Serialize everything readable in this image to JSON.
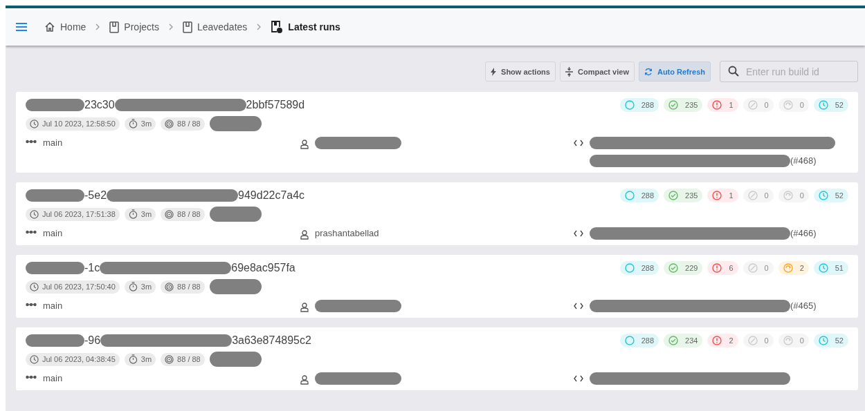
{
  "breadcrumbs": [
    {
      "label": "Home",
      "kind": "home"
    },
    {
      "label": "Projects",
      "kind": "project"
    },
    {
      "label": "Leavedates",
      "kind": "project"
    },
    {
      "label": "Latest runs",
      "kind": "runs"
    }
  ],
  "toolbar": {
    "buttons": [
      {
        "label": "Show actions",
        "kind": "actions",
        "selected": false
      },
      {
        "label": "Compact view",
        "kind": "compact",
        "selected": false
      },
      {
        "label": "Auto Refresh",
        "kind": "refresh",
        "selected": true
      }
    ],
    "search": {
      "placeholder": "Enter run build id"
    }
  },
  "runs": [
    {
      "title": [
        {
          "kind": "redacted"
        },
        {
          "kind": "text",
          "text": "23c30"
        },
        {
          "kind": "redacted"
        },
        {
          "kind": "text",
          "text": "2bbf57589d"
        }
      ],
      "date": "Jul 10 2023, 12:58:50",
      "duration": "3m",
      "tests": "88 / 88",
      "stats": [
        {
          "kind": "total",
          "value": "288",
          "muted": false
        },
        {
          "kind": "passed",
          "value": "235",
          "muted": false
        },
        {
          "kind": "failed",
          "value": "1",
          "muted": false
        },
        {
          "kind": "broken",
          "value": "0",
          "muted": true
        },
        {
          "kind": "flaky",
          "value": "0",
          "muted": true
        },
        {
          "kind": "time",
          "value": "52",
          "muted": false
        }
      ],
      "branch": "main",
      "author": [
        {
          "kind": "redacted"
        }
      ],
      "commit": [
        {
          "kind": "redacted"
        },
        {
          "kind": "redacted"
        },
        {
          "kind": "text",
          "text": "(#468)"
        }
      ]
    },
    {
      "title": [
        {
          "kind": "redacted"
        },
        {
          "kind": "text",
          "text": "-5e2"
        },
        {
          "kind": "redacted"
        },
        {
          "kind": "text",
          "text": "949d22c7a4c"
        }
      ],
      "date": "Jul 06 2023, 17:51:38",
      "duration": "3m",
      "tests": "88 / 88",
      "stats": [
        {
          "kind": "total",
          "value": "288",
          "muted": false
        },
        {
          "kind": "passed",
          "value": "235",
          "muted": false
        },
        {
          "kind": "failed",
          "value": "1",
          "muted": false
        },
        {
          "kind": "broken",
          "value": "0",
          "muted": true
        },
        {
          "kind": "flaky",
          "value": "0",
          "muted": true
        },
        {
          "kind": "time",
          "value": "52",
          "muted": false
        }
      ],
      "branch": "main",
      "author": [
        {
          "kind": "text",
          "text": "prashantabellad"
        }
      ],
      "commit": [
        {
          "kind": "redacted"
        },
        {
          "kind": "text",
          "text": "(#466)"
        }
      ]
    },
    {
      "title": [
        {
          "kind": "redacted"
        },
        {
          "kind": "text",
          "text": "-1c"
        },
        {
          "kind": "redacted"
        },
        {
          "kind": "text",
          "text": "69e8ac957fa"
        }
      ],
      "date": "Jul 06 2023, 17:50:40",
      "duration": "3m",
      "tests": "88 / 88",
      "stats": [
        {
          "kind": "total",
          "value": "288",
          "muted": false
        },
        {
          "kind": "passed",
          "value": "229",
          "muted": false
        },
        {
          "kind": "failed",
          "value": "6",
          "muted": false
        },
        {
          "kind": "broken",
          "value": "0",
          "muted": true
        },
        {
          "kind": "flaky",
          "value": "2",
          "muted": false
        },
        {
          "kind": "time",
          "value": "51",
          "muted": false
        }
      ],
      "branch": "main",
      "author": [
        {
          "kind": "redacted"
        }
      ],
      "commit": [
        {
          "kind": "redacted"
        },
        {
          "kind": "text",
          "text": "(#465)"
        }
      ]
    },
    {
      "title": [
        {
          "kind": "redacted"
        },
        {
          "kind": "text",
          "text": "-96"
        },
        {
          "kind": "redacted"
        },
        {
          "kind": "text",
          "text": "3a63e874895c2"
        }
      ],
      "date": "Jul 06 2023, 04:38:45",
      "duration": "3m",
      "tests": "88 / 88",
      "stats": [
        {
          "kind": "total",
          "value": "288",
          "muted": false
        },
        {
          "kind": "passed",
          "value": "234",
          "muted": false
        },
        {
          "kind": "failed",
          "value": "2",
          "muted": false
        },
        {
          "kind": "broken",
          "value": "0",
          "muted": true
        },
        {
          "kind": "flaky",
          "value": "0",
          "muted": true
        },
        {
          "kind": "time",
          "value": "52",
          "muted": false
        }
      ],
      "branch": "main",
      "author": [
        {
          "kind": "redacted"
        }
      ],
      "commit": [
        {
          "kind": "redacted"
        }
      ]
    }
  ]
}
